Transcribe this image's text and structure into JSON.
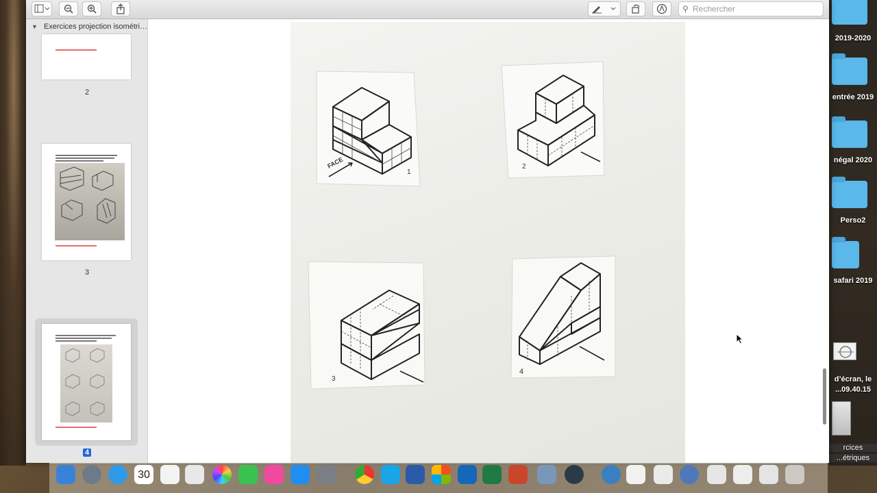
{
  "toolbar": {
    "search_placeholder": "Rechercher"
  },
  "sidebar": {
    "doc_title": "Exercices projection isométri…",
    "pages": [
      {
        "label": "2"
      },
      {
        "label": "3"
      },
      {
        "label": "4",
        "selected": true
      }
    ]
  },
  "document": {
    "drawings": [
      {
        "label": "FACE"
      },
      {
        "label": "1"
      },
      {
        "label": "2"
      },
      {
        "label": "3"
      },
      {
        "label": "4"
      }
    ]
  },
  "desktop": {
    "items": [
      {
        "label": "2019-2020"
      },
      {
        "label": "entrée 2019"
      },
      {
        "label": "négal 2020"
      },
      {
        "label": "Perso2"
      },
      {
        "label": "safari 2019"
      },
      {
        "label_line1": "d’écran, le",
        "label_line2": "...09.40.15"
      },
      {
        "label_line1": "rcices",
        "label_line2": "...étriques"
      }
    ]
  },
  "dock": {
    "calendar_day": "30"
  },
  "colors": {
    "accent": "#2167d8",
    "folder": "#5ab8ea"
  }
}
